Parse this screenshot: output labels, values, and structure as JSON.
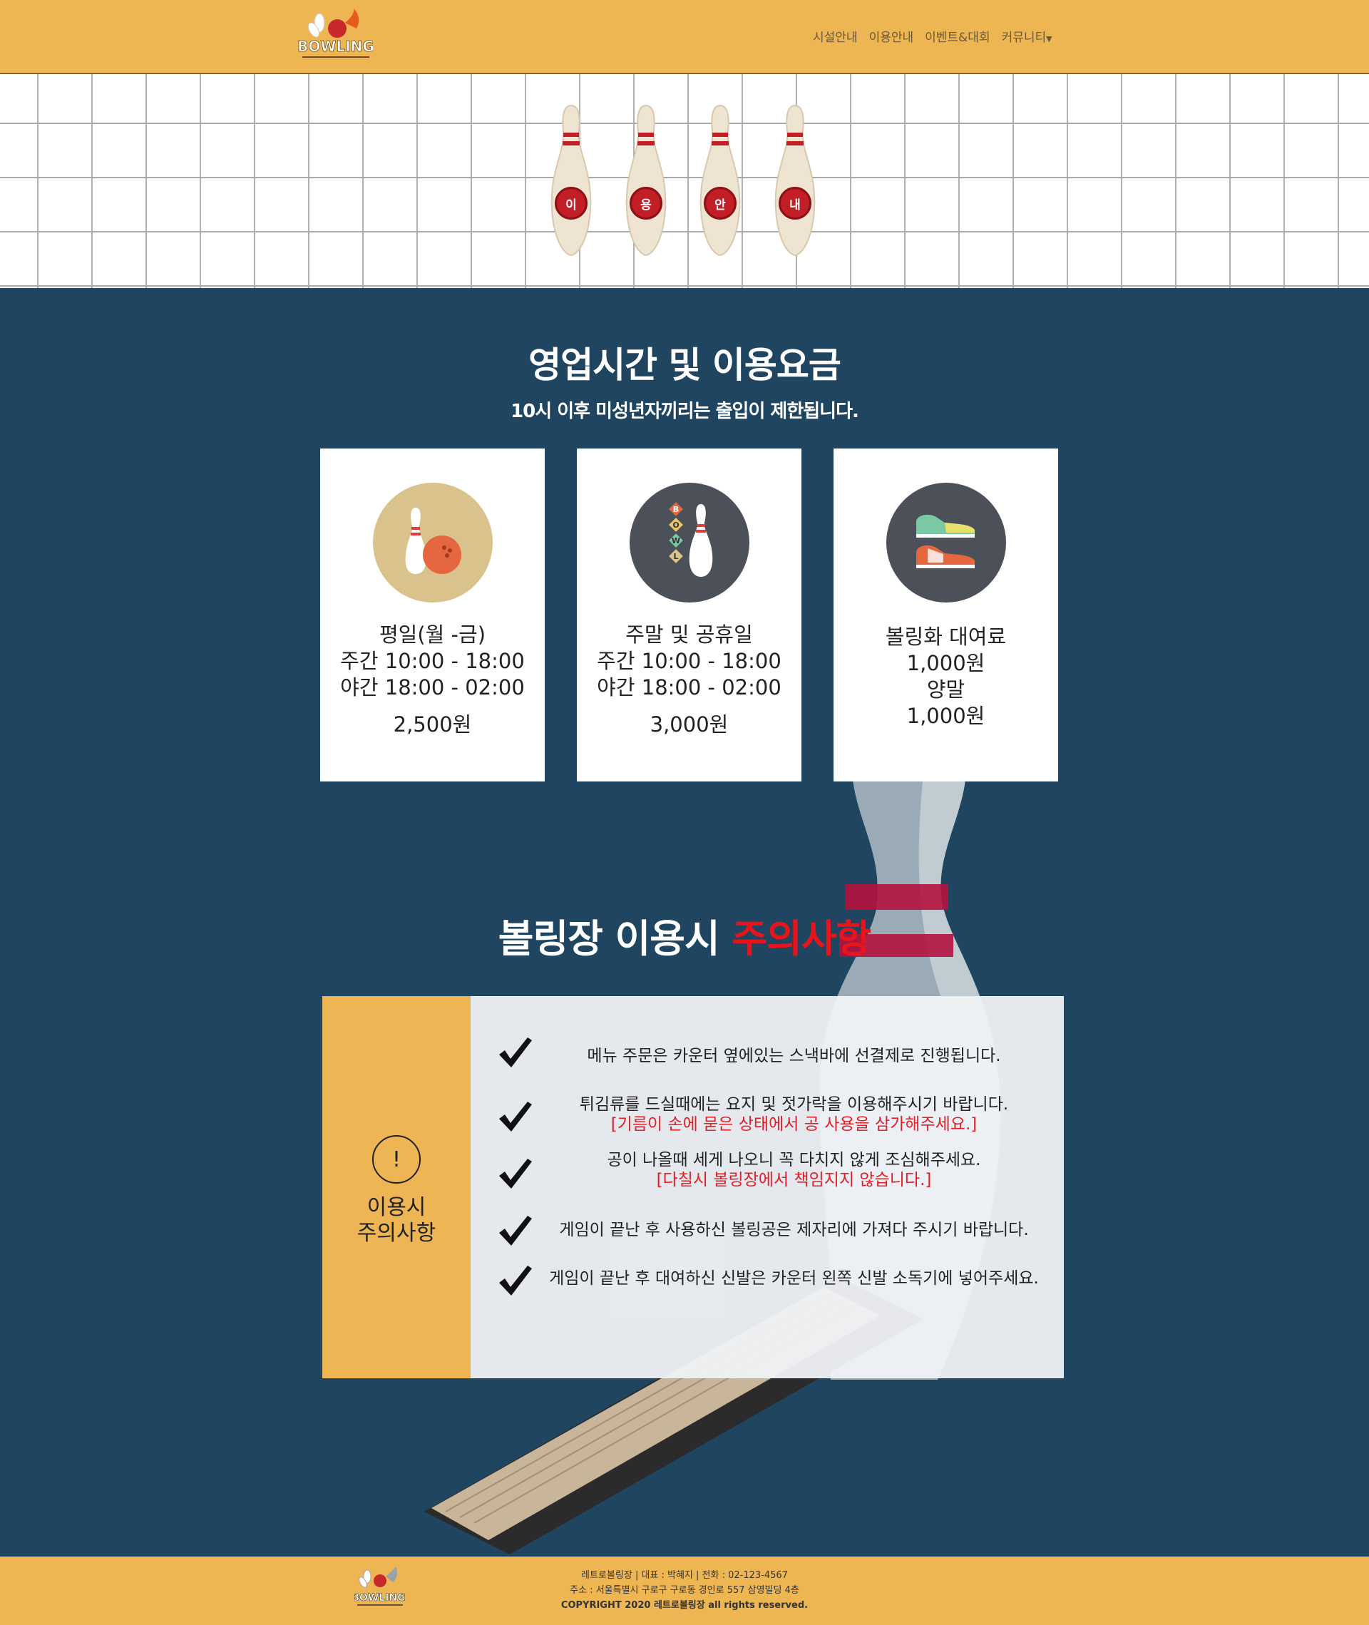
{
  "header": {
    "logo_text": "BOWLING",
    "nav": [
      {
        "label": "시설안내"
      },
      {
        "label": "이용안내"
      },
      {
        "label": "이벤트&대회"
      },
      {
        "label": "커뮤니티"
      }
    ]
  },
  "hero": {
    "pins": [
      "이",
      "용",
      "안",
      "내"
    ]
  },
  "hours": {
    "title": "영업시간 및 이용요금",
    "subtitle": "10시 이후 미성년자끼리는 출입이 제한됩니다.",
    "cards": [
      {
        "icon": "bowling-pin-ball-icon",
        "title": "평일(월 -금)",
        "day": "주간 10:00 - 18:00",
        "night": "야간 18:00 - 02:00",
        "price": "2,500원",
        "color": "#d9c28b"
      },
      {
        "icon": "bowl-pin-icon",
        "title": "주말 및 공휴일",
        "day": "주간 10:00 - 18:00",
        "night": "야간 18:00 - 02:00",
        "price": "3,000원",
        "color": "#4c5058"
      },
      {
        "icon": "bowling-shoes-icon",
        "lines": [
          "볼링화 대여료",
          "1,000원",
          "양말",
          "1,000원"
        ],
        "color": "#4c5058"
      }
    ]
  },
  "caution": {
    "title_main": "볼링장 이용시 ",
    "title_accent": "주의사항",
    "side_icon": "!",
    "side_title": [
      "이용시",
      "주의사항"
    ],
    "rules": [
      {
        "text": "메뉴 주문은 카운터 옆에있는 스낵바에 선결제로 진행됩니다.",
        "warn": ""
      },
      {
        "text": "튀김류를 드실때에는 요지 및 젓가락을 이용해주시기 바랍니다.",
        "warn": "[기름이 손에 묻은 상태에서 공 사용을 삼가해주세요.]"
      },
      {
        "text": "공이 나올때 세게 나오니 꼭 다치지 않게 조심해주세요.",
        "warn": "[다칠시 볼링장에서 책임지지 않습니다.]"
      },
      {
        "text": "게임이 끝난 후 사용하신 볼링공은 제자리에 가져다 주시기 바랍니다.",
        "warn": ""
      },
      {
        "text": "게임이 끝난 후 대여하신 신발은 카운터 왼쪽 신발 소독기에 넣어주세요.",
        "warn": ""
      }
    ],
    "accent_color": "#e8141b"
  },
  "footer": {
    "line1": "레트로볼링장  |  대표 : 박혜지  |  전화 : 02-123-4567",
    "line2": "주소 : 서울특별시 구로구 구로동 경인로 557 삼영빌딩 4층",
    "line3": "COPYRIGHT 2020 레트로볼링장 all rights reserved.",
    "logo_text": "BOWLING"
  }
}
